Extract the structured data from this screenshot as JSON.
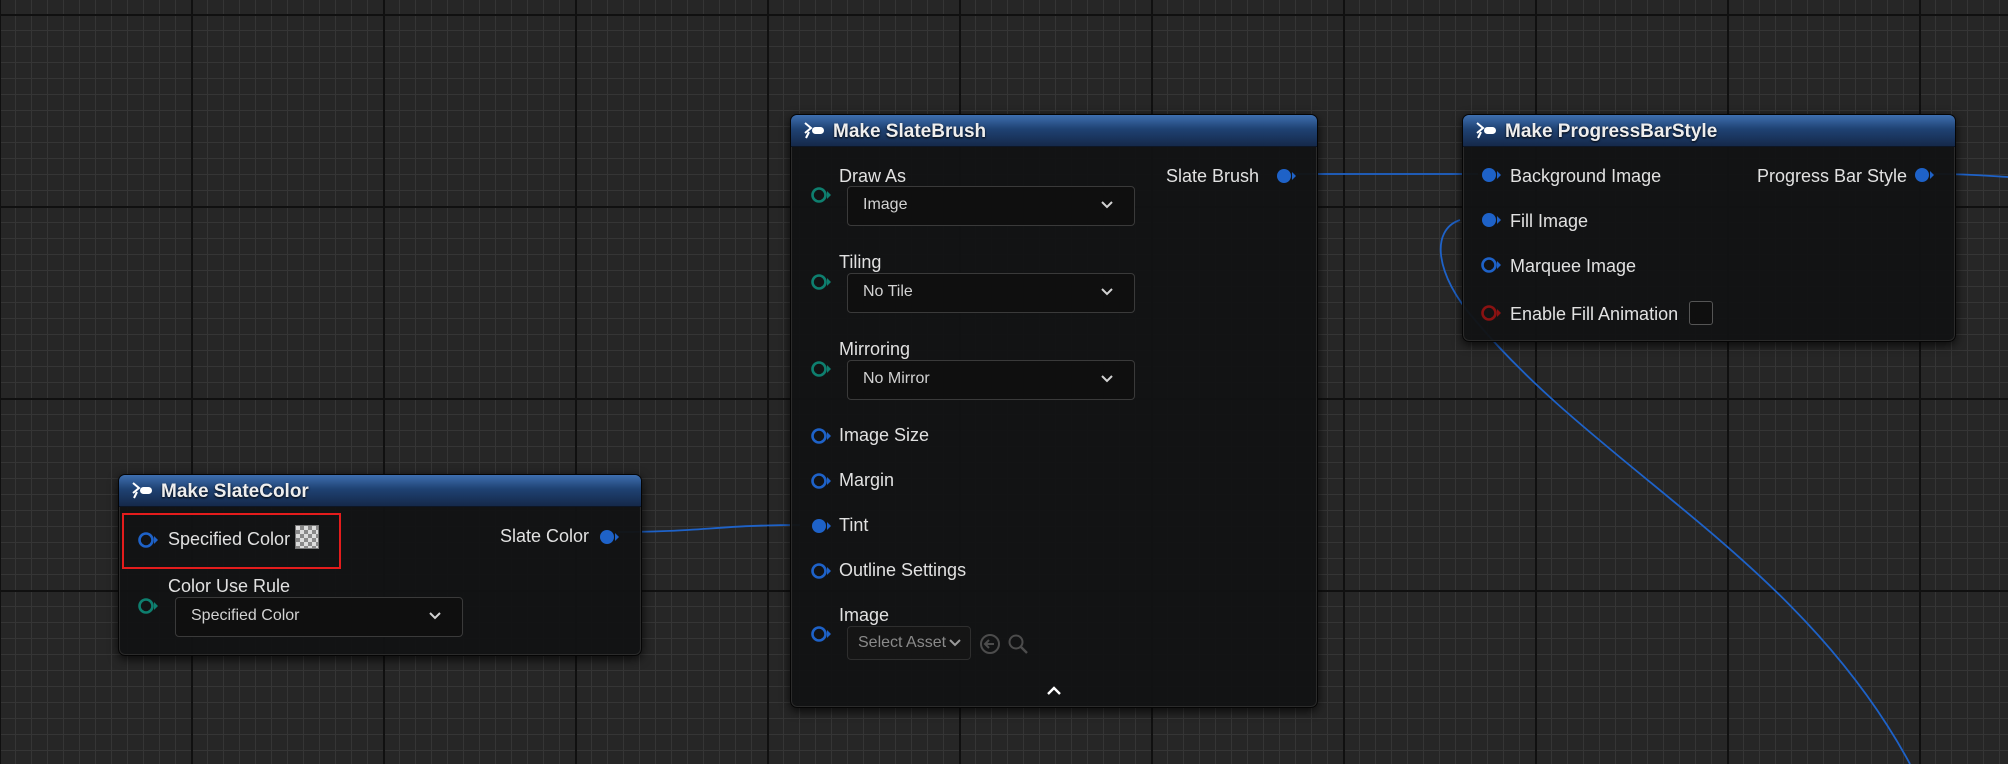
{
  "graph": {
    "wire_color": "#1e62c8",
    "header_color": "#1f4273"
  },
  "nodes": {
    "make_slate_color": {
      "title": "Make SlateColor",
      "inputs": {
        "specified_color": "Specified Color",
        "color_use_rule": "Color Use Rule",
        "color_use_rule_value": "Specified Color"
      },
      "outputs": {
        "slate_color": "Slate Color"
      }
    },
    "make_slate_brush": {
      "title": "Make SlateBrush",
      "inputs": {
        "draw_as": "Draw As",
        "draw_as_value": "Image",
        "tiling": "Tiling",
        "tiling_value": "No Tile",
        "mirroring": "Mirroring",
        "mirroring_value": "No Mirror",
        "image_size": "Image Size",
        "margin": "Margin",
        "tint": "Tint",
        "outline_settings": "Outline Settings",
        "image": "Image",
        "image_value_placeholder": "Select Asset"
      },
      "outputs": {
        "slate_brush": "Slate Brush"
      },
      "collapse_icon": "chevron-up-icon"
    },
    "make_progress_bar_style": {
      "title": "Make ProgressBarStyle",
      "inputs": {
        "background_image": "Background Image",
        "fill_image": "Fill Image",
        "marquee_image": "Marquee Image",
        "enable_fill_animation": "Enable Fill Animation",
        "enable_fill_animation_checked": false
      },
      "outputs": {
        "progress_bar_style": "Progress Bar Style"
      }
    }
  },
  "pin_colors": {
    "struct": "#1e62c8",
    "enum": "#0e7f6f",
    "bool": "#8a1212"
  },
  "highlight_color": "#e41c1c"
}
